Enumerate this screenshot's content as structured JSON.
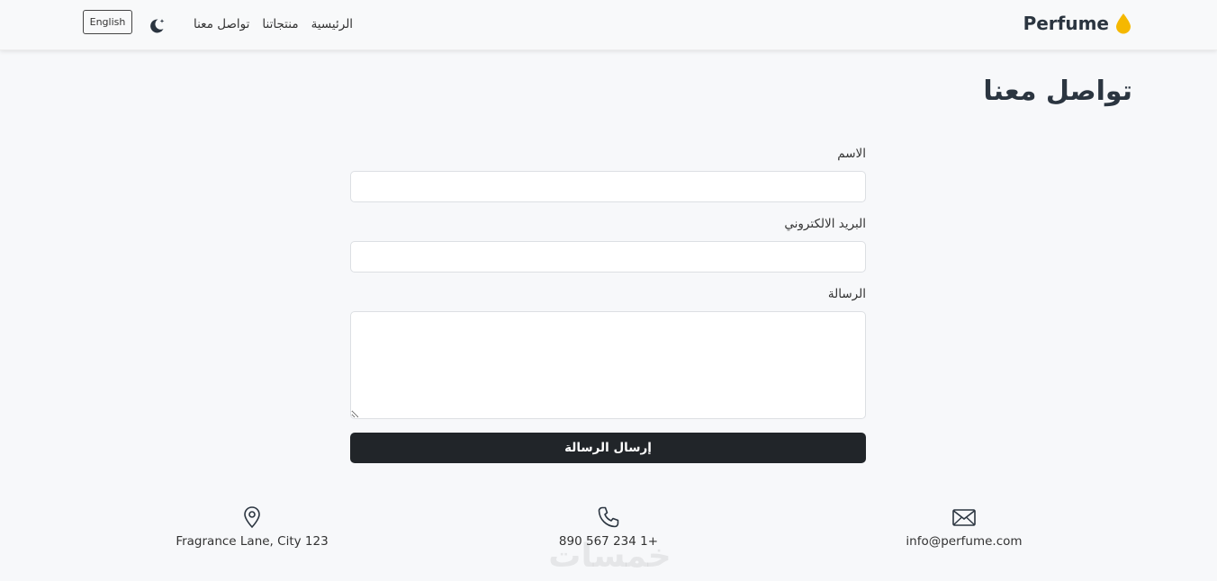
{
  "brand": {
    "name": "Perfume",
    "icon": "drop-icon",
    "icon_color": "#f5b800"
  },
  "nav": {
    "links": [
      "الرئيسية",
      "منتجاتنا",
      "تواصل معنا"
    ],
    "theme_toggle_icon": "moon-icon",
    "language_button": "English"
  },
  "page": {
    "title": "تواصل معنا"
  },
  "form": {
    "name_label": "الاسم",
    "name_value": "",
    "email_label": "البريد الالكتروني",
    "email_value": "",
    "message_label": "الرسالة",
    "message_value": "",
    "submit_label": "إرسال الرسالة"
  },
  "contact": {
    "address": {
      "icon": "map-pin-icon",
      "text": "Fragrance Lane, City 123"
    },
    "phone": {
      "icon": "phone-icon",
      "text": "+1 234 567 890"
    },
    "email": {
      "icon": "envelope-icon",
      "text": "info@perfume.com"
    }
  },
  "watermark": {
    "text": "خمسات"
  },
  "colors": {
    "button_bg": "#212529",
    "page_bg": "#f7f8fa",
    "navbar_bg": "#f8f9fa"
  }
}
